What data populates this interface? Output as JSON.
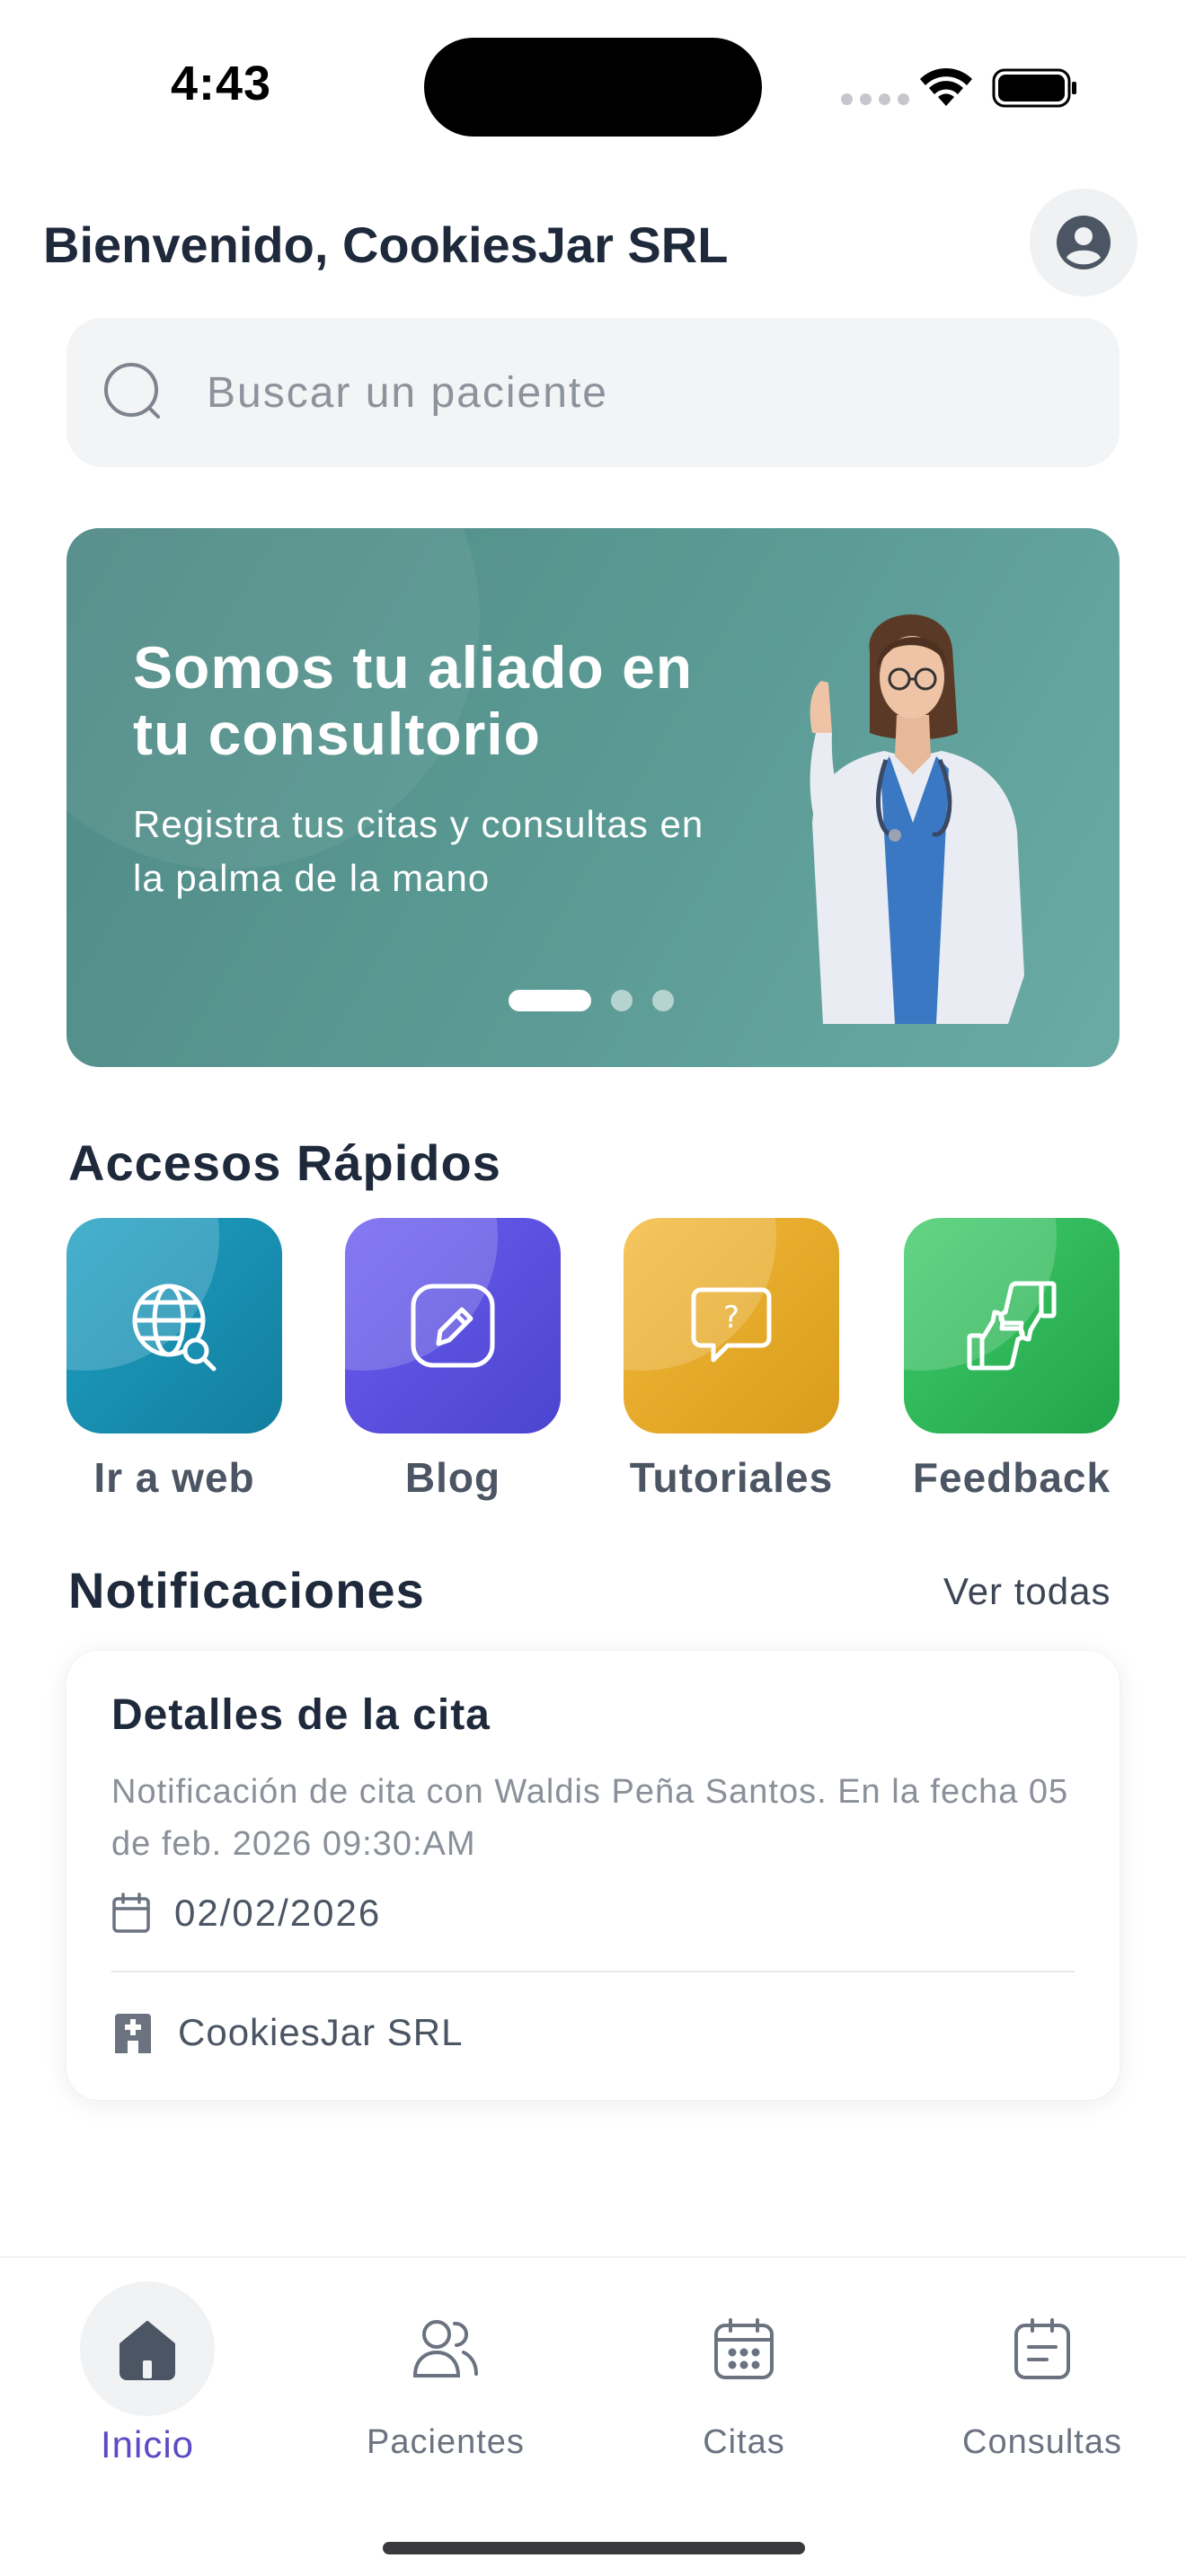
{
  "status_bar": {
    "time": "4:43"
  },
  "header": {
    "greeting": "Bienvenido, CookiesJar SRL",
    "profile_icon": "user-circle-icon"
  },
  "search": {
    "placeholder": "Buscar un paciente",
    "value": "",
    "icon": "search-icon"
  },
  "banner": {
    "title": "Somos tu aliado en tu consultorio",
    "subtitle": "Registra tus citas y consultas en la palma de la mano",
    "slides_total": 3,
    "active_slide": 1,
    "color": "#5c9b95"
  },
  "quick_access": {
    "title": "Accesos Rápidos",
    "items": [
      {
        "label": "Ir a web",
        "icon": "globe-search-icon",
        "color": "#1a90b4"
      },
      {
        "label": "Blog",
        "icon": "edit-pencil-icon",
        "color": "#5a50e0"
      },
      {
        "label": "Tutoriales",
        "icon": "question-chat-icon",
        "color": "#e8ac2c"
      },
      {
        "label": "Feedback",
        "icon": "thumbs-up-down-icon",
        "color": "#2db657"
      }
    ]
  },
  "notifications": {
    "title": "Notificaciones",
    "see_all": "Ver todas",
    "items": [
      {
        "title": "Detalles de la cita",
        "body": "Notificación de cita con Waldis Peña Santos. En la fecha 05 de feb. 2026 09:30:AM",
        "date": "02/02/2026",
        "clinic": "CookiesJar SRL"
      }
    ]
  },
  "bottom_nav": {
    "active": "Inicio",
    "accent_color": "#5b4bc4",
    "items": [
      {
        "label": "Inicio",
        "icon": "home-icon"
      },
      {
        "label": "Pacientes",
        "icon": "users-icon"
      },
      {
        "label": "Citas",
        "icon": "calendar-icon"
      },
      {
        "label": "Consultas",
        "icon": "clipboard-icon"
      }
    ]
  }
}
